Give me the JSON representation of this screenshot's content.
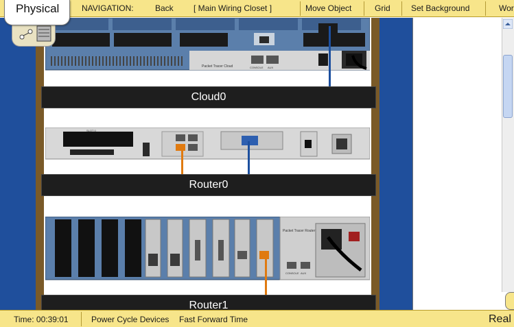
{
  "header": {
    "mode_tab": "Physical",
    "navigation_label": "NAVIGATION:",
    "back": "Back",
    "location": "[ Main Wiring Closet ]",
    "move_object": "Move Object",
    "grid": "Grid",
    "set_background": "Set Background",
    "working_closet_truncated": "Wor"
  },
  "devices": [
    {
      "name": "Cloud0",
      "panel_label": "Packet Tracer Cloud",
      "ports": [
        "CONSOLE",
        "AUX"
      ]
    },
    {
      "name": "Router0",
      "panel_label": "SLOT 0"
    },
    {
      "name": "Router1",
      "panel_label": "Packet Tracer Router",
      "ports": [
        "CONSOLE",
        "AUX"
      ]
    }
  ],
  "status": {
    "time": "Time: 00:39:01",
    "power_cycle": "Power Cycle Devices",
    "fast_forward": "Fast Forward Time",
    "realtime_truncated": "Real"
  },
  "colors": {
    "toolbar": "#f7e58a",
    "workspace": "#1f4f9c",
    "rack_rail": "#7a5a28",
    "label_bar": "#1e1e1e",
    "cable_blue": "#1c4f9e",
    "cable_orange": "#e07a10"
  }
}
